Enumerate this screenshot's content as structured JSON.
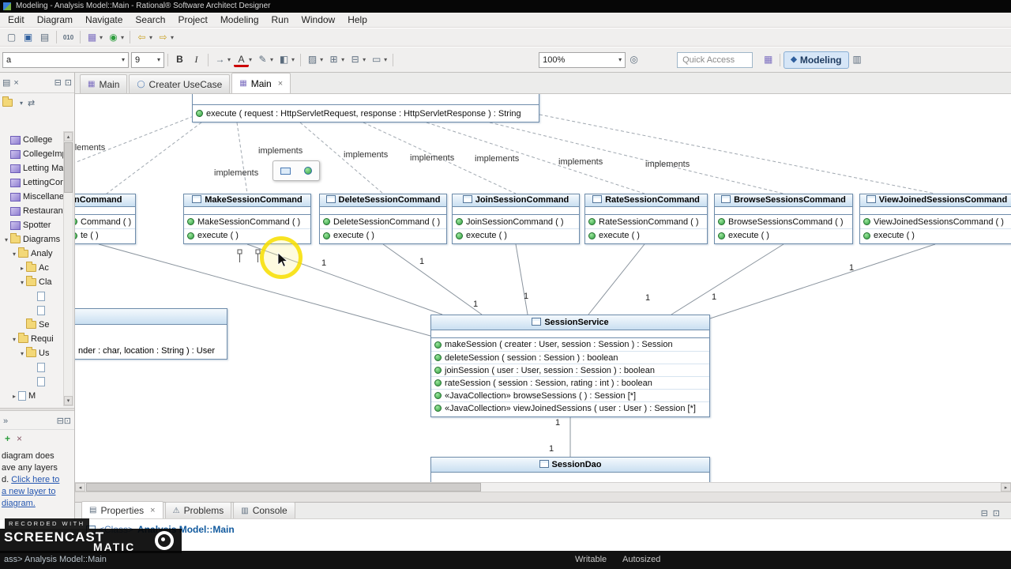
{
  "window": {
    "title": "Modeling - Analysis Model::Main - Rational® Software Architect Designer"
  },
  "menu": {
    "items": [
      "Edit",
      "Diagram",
      "Navigate",
      "Search",
      "Project",
      "Modeling",
      "Run",
      "Window",
      "Help"
    ]
  },
  "glyphs": {
    "dropdown": "▾",
    "up": "▴",
    "down": "▾",
    "left": "◂",
    "right": "▸",
    "close": "×",
    "chevrons": "»",
    "min": "⊟",
    "max": "⊡",
    "menu": "▤",
    "link": "⇄",
    "plus": "+",
    "warn": "⚠",
    "diagram": "▦",
    "usecase": "◯",
    "console": "▥",
    "properties": "▤",
    "folder_dd": "▾"
  },
  "toolbar1": {
    "new": "▢",
    "save": "▣",
    "print": "▤",
    "binary": "010",
    "model": "▦",
    "run": "◉",
    "back": "⇦",
    "forward": "⇨"
  },
  "toolbar2": {
    "font_value": "a",
    "size": "9",
    "bold": "B",
    "italic": "I",
    "arrow": "→",
    "font_color": "A",
    "pencil": "✎",
    "fill": "◧",
    "pattern": "▨",
    "grid_plus": "⊞",
    "grid_minus": "⊟",
    "shape": "▭",
    "zoom": "100%",
    "magnifier": "◎",
    "quick_access": "Quick Access",
    "persp_icon": "◆",
    "perspective": "Modeling",
    "extra_icon": "▥"
  },
  "explorer": {
    "items": [
      {
        "arrow": "",
        "label": "College"
      },
      {
        "arrow": "",
        "label": "CollegeImple"
      },
      {
        "arrow": "",
        "label": "Letting Mana"
      },
      {
        "arrow": "",
        "label": "LettingComp"
      },
      {
        "arrow": "",
        "label": "Miscellaneou"
      },
      {
        "arrow": "",
        "label": "Restaurant M"
      },
      {
        "arrow": "",
        "label": "Spotter"
      },
      {
        "arrow": "▾",
        "label": "Diagrams"
      },
      {
        "arrow": "▾",
        "label": "Analy"
      },
      {
        "arrow": "▸",
        "label": "Ac"
      },
      {
        "arrow": "▾",
        "label": "Cla"
      },
      {
        "arrow": "",
        "label": ""
      },
      {
        "arrow": "",
        "label": ""
      },
      {
        "arrow": "",
        "label": "Se"
      },
      {
        "arrow": "▾",
        "label": "Requi"
      },
      {
        "arrow": "▾",
        "label": "Us"
      },
      {
        "arrow": "",
        "label": ""
      },
      {
        "arrow": "",
        "label": ""
      },
      {
        "arrow": "▸",
        "label": "M"
      }
    ]
  },
  "help": {
    "line1": "diagram does",
    "line2": "ave any layers",
    "line3_pre": "d. ",
    "line3_link": "Click here to",
    "line4_link": "a new layer to",
    "line5_link": "diagram."
  },
  "editor": {
    "tabs": [
      {
        "label": "Main"
      },
      {
        "label": "Creater UseCase"
      },
      {
        "label": "Main"
      }
    ]
  },
  "diagram": {
    "interface_op": "execute ( request : HttpServletRequest, response : HttpServletResponse ) : String",
    "implements": "implements",
    "one": "1",
    "commands": [
      {
        "name": "nCommand",
        "ctor": "Command ( )",
        "exec": "te ( )"
      },
      {
        "name": "MakeSessionCommand",
        "ctor": "MakeSessionCommand ( )",
        "exec": "execute ( )"
      },
      {
        "name": "DeleteSessionCommand",
        "ctor": "DeleteSessionCommand ( )",
        "exec": "execute ( )"
      },
      {
        "name": "JoinSessionCommand",
        "ctor": "JoinSessionCommand ( )",
        "exec": "execute ( )"
      },
      {
        "name": "RateSessionCommand",
        "ctor": "RateSessionCommand ( )",
        "exec": "execute ( )"
      },
      {
        "name": "BrowseSessionsCommand",
        "ctor": "BrowseSessionsCommand ( )",
        "exec": "execute ( )"
      },
      {
        "name": "ViewJoinedSessionsCommand",
        "ctor": "ViewJoinedSessionsCommand ( )",
        "exec": "execute ( )"
      }
    ],
    "service": {
      "name": "SessionService",
      "ops": [
        "makeSession ( creater : User, session : Session ) : Session",
        "deleteSession ( session : Session ) : boolean",
        "joinSession ( user : User, session : Session ) : boolean",
        "rateSession ( session : Session, rating : int ) : boolean",
        "«JavaCollection» browseSessions ( ) : Session [*]",
        "«JavaCollection» viewJoinedSessions ( user : User ) : Session [*]"
      ]
    },
    "dao": {
      "name": "SessionDao"
    },
    "partial_text": "nder : char, location : String ) : User"
  },
  "bottom": {
    "tabs": [
      {
        "label": "Properties"
      },
      {
        "label": "Problems"
      },
      {
        "label": "Console"
      }
    ],
    "selection_prefix": "<Class>",
    "selection_name": "Analysis Model::Main"
  },
  "status": {
    "left": "ass> Analysis Model::Main",
    "writable": "Writable",
    "autosized": "Autosized"
  },
  "watermark": {
    "recorded": "RECORDED WITH",
    "brand_top": "SCREENCAST",
    "brand_bottom": "MATIC"
  }
}
